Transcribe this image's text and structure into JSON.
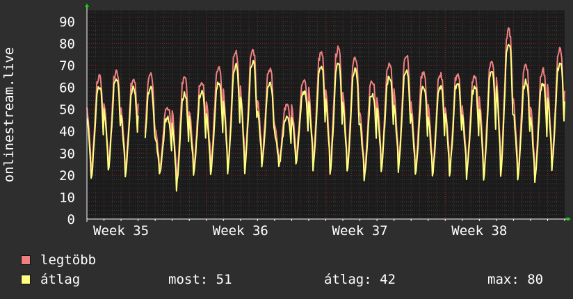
{
  "chart_data": {
    "type": "line",
    "ylabel": "onlinestream.live",
    "ylim": [
      0,
      95
    ],
    "yticks": [
      0,
      10,
      20,
      30,
      40,
      50,
      60,
      70,
      80,
      90
    ],
    "week_labels": [
      "Week 35",
      "Week 36",
      "Week 37",
      "Week 38"
    ],
    "x_unit": "days",
    "x_range": [
      0,
      28
    ],
    "week_label_days": [
      2,
      9,
      16,
      23
    ],
    "grid": true,
    "daily_peaks": {
      "legtobb": [
        65,
        67,
        64,
        66,
        51,
        65,
        63,
        69,
        76,
        77,
        68,
        52,
        63,
        76,
        78,
        74,
        63,
        71,
        75,
        67,
        66,
        66,
        65,
        72,
        86,
        70,
        68,
        77,
        71
      ],
      "atlag": [
        60,
        64,
        60,
        60,
        46,
        57,
        58,
        62,
        70,
        72,
        62,
        47,
        58,
        70,
        71,
        68,
        57,
        65,
        68,
        60,
        60,
        62,
        60,
        67,
        80,
        63,
        62,
        71,
        65
      ]
    },
    "daily_troughs": {
      "legtobb": [
        20,
        24,
        22,
        24,
        22,
        16,
        22,
        23,
        22,
        23,
        26,
        26,
        27,
        24,
        22,
        23,
        20,
        24,
        23,
        22,
        21,
        22,
        21,
        20,
        21,
        20,
        18,
        25,
        30
      ],
      "atlag": [
        18,
        22,
        20,
        22,
        20,
        14,
        20,
        20,
        20,
        21,
        24,
        24,
        25,
        22,
        20,
        21,
        18,
        22,
        21,
        20,
        19,
        20,
        19,
        18,
        19,
        18,
        16,
        23,
        28
      ]
    },
    "gap_days": [
      [
        3.0,
        3.4
      ]
    ],
    "series": [
      {
        "name": "legtöbb",
        "color": "#f08080"
      },
      {
        "name": "átlag",
        "color": "#ffff80"
      }
    ]
  },
  "legend": {
    "max_series_label": "legtöbb",
    "avg_series_label": "átlag",
    "stat_now": "most: 51",
    "stat_avg": "átlag: 42",
    "stat_max": "max: 80"
  },
  "colors": {
    "background": "#2e2e2e",
    "plot_background": "#1b1b1b",
    "grid_major": "#8a2020",
    "grid_minor": "#3e3e3e",
    "axis_arrow": "#00e000"
  }
}
